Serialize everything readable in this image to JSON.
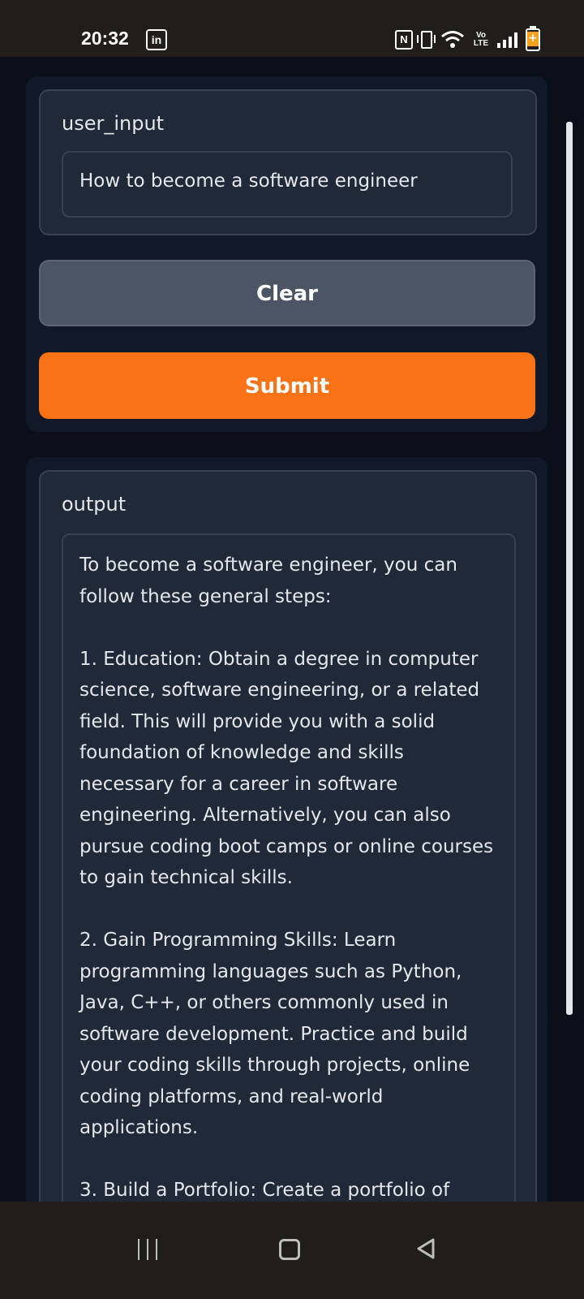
{
  "status_bar": {
    "time": "20:32",
    "linkedin_icon_text": "in",
    "nfc_icon_text": "N",
    "volte_text_top": "Vo",
    "volte_text_bottom": "LTE"
  },
  "input_panel": {
    "label": "user_input",
    "value": "How to become a software engineer",
    "clear_label": "Clear",
    "submit_label": "Submit",
    "submit_color": "#f97316"
  },
  "output_panel": {
    "label": "output",
    "text": "To become a software engineer, you can\nfollow these general steps:\n\n1. Education: Obtain a degree in computer\nscience, software engineering, or a related\nfield. This will provide you with a solid\nfoundation of knowledge and skills\nnecessary for a career in software\nengineering. Alternatively, you can also\npursue coding boot camps or online courses\nto gain technical skills.\n\n2. Gain Programming Skills: Learn\nprogramming languages such as Python,\nJava, C++, or others commonly used in\nsoftware development. Practice and build\nyour coding skills through projects, online\ncoding platforms, and real-world\napplications.\n\n3. Build a Portfolio: Create a portfolio of"
  },
  "nav_bar": {
    "icons": [
      "menu-icon",
      "home-icon",
      "back-icon"
    ]
  }
}
